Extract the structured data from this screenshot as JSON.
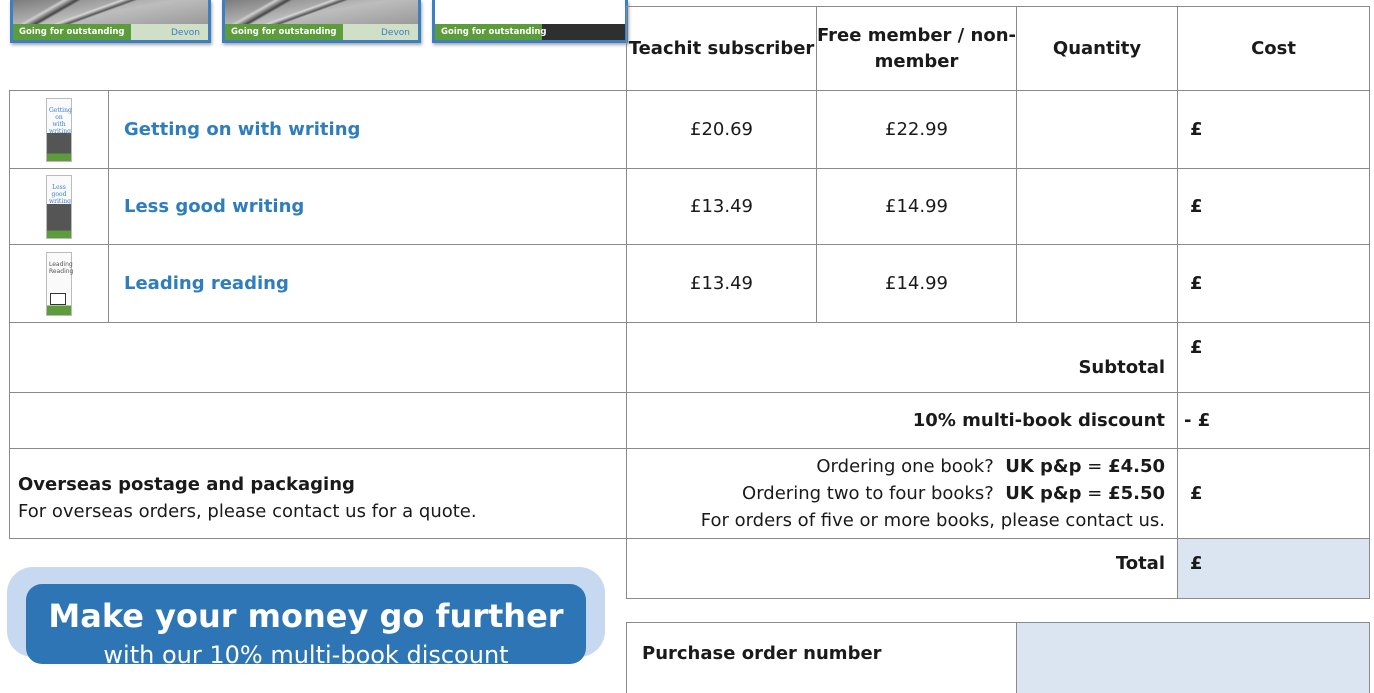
{
  "thumbnails": [
    {
      "band": "Going for outstanding",
      "logo": "Devon"
    },
    {
      "band": "Going for outstanding",
      "logo": "Devon"
    },
    {
      "band": "Going for outstanding",
      "logo": ""
    }
  ],
  "headers": {
    "teachit": "Teachit subscriber",
    "free": "Free member / non-member",
    "quantity": "Quantity",
    "cost": "Cost"
  },
  "books": [
    {
      "title": "Getting on with writing",
      "cover_text": "Getting on with writing",
      "teachit": "£20.69",
      "free": "£22.99",
      "quantity": "",
      "cost": "£"
    },
    {
      "title": "Less good writing",
      "cover_text": "Less good writing",
      "teachit": "£13.49",
      "free": "£14.99",
      "quantity": "",
      "cost": "£"
    },
    {
      "title": "Leading reading",
      "cover_text": "Leading Reading",
      "teachit": "£13.49",
      "free": "£14.99",
      "quantity": "",
      "cost": "£"
    }
  ],
  "subtotal": {
    "label": "Subtotal",
    "value": "£"
  },
  "discount": {
    "label": "10% multi-book discount",
    "value": "- £"
  },
  "postage": {
    "title": "Overseas postage and packaging",
    "note": "For overseas orders, please contact us for a quote.",
    "line1_pre": "Ordering one book?",
    "line1_label": "UK p&p",
    "line1_eq": "=",
    "line1_price": "£4.50",
    "line2_pre": "Ordering two to four books?",
    "line2_label": "UK p&p",
    "line2_eq": "=",
    "line2_price": "£5.50",
    "line3": "For orders of five or more books, please contact us.",
    "value": "£"
  },
  "total": {
    "label": "Total",
    "value": "£"
  },
  "purchase_order": {
    "label": "Purchase order number",
    "value": ""
  },
  "promo": {
    "title": "Make your money go further",
    "subtitle": "with our 10% multi-book discount"
  }
}
